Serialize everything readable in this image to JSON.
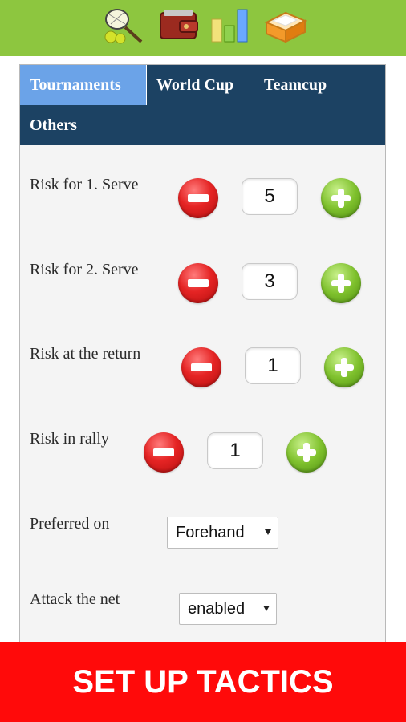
{
  "toolbar": {
    "icons": [
      {
        "name": "tennis-racket-icon"
      },
      {
        "name": "wallet-icon"
      },
      {
        "name": "bar-chart-icon"
      },
      {
        "name": "inbox-tray-icon"
      }
    ]
  },
  "tabs": {
    "tournaments": "Tournaments",
    "world_cup": "World Cup",
    "teamcup": "Teamcup",
    "others": "Others",
    "active": "Tournaments"
  },
  "settings": {
    "serve1": {
      "label": "Risk for 1. Serve",
      "value": "5"
    },
    "serve2": {
      "label": "Risk for 2. Serve",
      "value": "3"
    },
    "return": {
      "label": "Risk at the return",
      "value": "1"
    },
    "rally": {
      "label": "Risk in rally",
      "value": "1"
    },
    "preferred": {
      "label": "Preferred on",
      "value": "Forehand"
    },
    "net": {
      "label": "Attack the net",
      "value": "enabled"
    }
  },
  "cta": {
    "label": "SET UP TACTICS"
  },
  "colors": {
    "header_green": "#8dc63f",
    "tab_bar": "#1c4263",
    "tab_active": "#6ba3e8",
    "cta_red": "#ff0a0a",
    "minus_red": "#e52424",
    "plus_green": "#7fc12d"
  }
}
